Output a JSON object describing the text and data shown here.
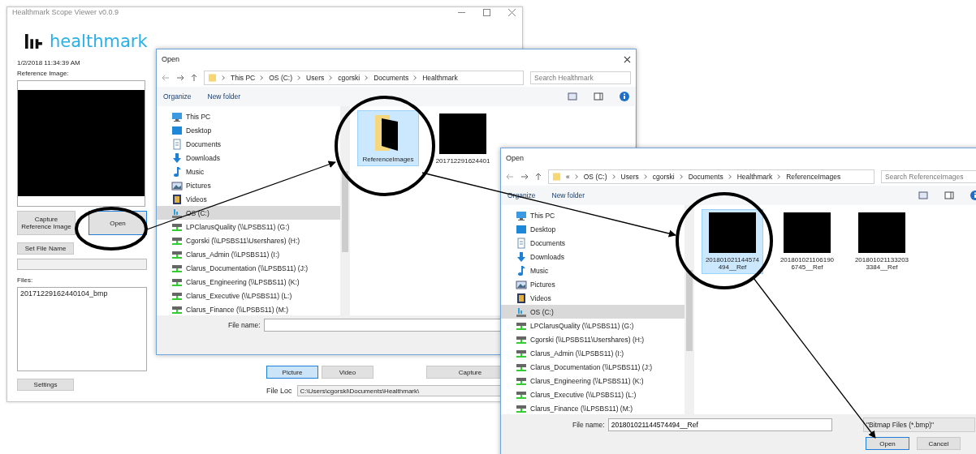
{
  "main_window": {
    "title": "Healthmark Scope Viewer v0.0.9",
    "logo_text": "healthmark",
    "datetime": "1/2/2018 11:34:39 AM",
    "reference_label": "Reference Image:",
    "action_buttons": [
      {
        "label": "Capture Reference Image",
        "focused": false
      },
      {
        "label": "Open",
        "focused": true
      }
    ],
    "set_file_name": "Set File Name",
    "files_label": "Files:",
    "files": [
      "20171229162440104_bmp"
    ],
    "settings": "Settings",
    "mode_buttons": [
      {
        "label": "Picture",
        "selected": true
      },
      {
        "label": "Video",
        "selected": false
      }
    ],
    "capture": "Capture",
    "file_loc_label": "File Loc",
    "file_loc_value": "C:\\Users\\cgorski\\Documents\\Healthmark\\"
  },
  "dialogs": [
    {
      "title": "Open",
      "closable": true,
      "breadcrumb": [
        "This PC",
        "OS (C:)",
        "Users",
        "cgorski",
        "Documents",
        "Healthmark"
      ],
      "search_placeholder": "Search Healthmark",
      "toolbar": [
        "Organize",
        "New folder"
      ],
      "nav_items": [
        {
          "label": "This PC",
          "kind": "pc",
          "selected": false
        },
        {
          "label": "Desktop",
          "kind": "desktop",
          "selected": false
        },
        {
          "label": "Documents",
          "kind": "documents",
          "selected": false
        },
        {
          "label": "Downloads",
          "kind": "downloads",
          "selected": false
        },
        {
          "label": "Music",
          "kind": "music",
          "selected": false
        },
        {
          "label": "Pictures",
          "kind": "pictures",
          "selected": false
        },
        {
          "label": "Videos",
          "kind": "videos",
          "selected": false
        },
        {
          "label": "OS (C:)",
          "kind": "drive",
          "selected": true
        },
        {
          "label": "LPClarusQuality (\\\\LPSBS11) (G:)",
          "kind": "network",
          "selected": false
        },
        {
          "label": "Cgorski (\\\\LPSBS11\\Usershares) (H:)",
          "kind": "network",
          "selected": false
        },
        {
          "label": "Clarus_Admin (\\\\LPSBS11) (I:)",
          "kind": "network",
          "selected": false
        },
        {
          "label": "Clarus_Documentation (\\\\LPSBS11) (J:)",
          "kind": "network",
          "selected": false
        },
        {
          "label": "Clarus_Engineering (\\\\LPSBS11) (K:)",
          "kind": "network",
          "selected": false
        },
        {
          "label": "Clarus_Executive (\\\\LPSBS11) (L:)",
          "kind": "network",
          "selected": false
        },
        {
          "label": "Clarus_Finance (\\\\LPSBS11) (M:)",
          "kind": "network",
          "selected": false
        }
      ],
      "files": [
        {
          "label": "ReferenceImages",
          "kind": "folder",
          "selected": true
        },
        {
          "label": "201712291624401",
          "kind": "image",
          "selected": false
        }
      ],
      "file_name_label": "File name:"
    },
    {
      "title": "Open",
      "closable": false,
      "breadcrumb": [
        "«",
        "OS (C:)",
        "Users",
        "cgorski",
        "Documents",
        "Healthmark",
        "ReferenceImages"
      ],
      "search_placeholder": "Search ReferenceImages",
      "toolbar": [
        "Organize",
        "New folder"
      ],
      "nav_items": [
        {
          "label": "This PC",
          "kind": "pc",
          "selected": false
        },
        {
          "label": "Desktop",
          "kind": "desktop",
          "selected": false
        },
        {
          "label": "Documents",
          "kind": "documents",
          "selected": false
        },
        {
          "label": "Downloads",
          "kind": "downloads",
          "selected": false
        },
        {
          "label": "Music",
          "kind": "music",
          "selected": false
        },
        {
          "label": "Pictures",
          "kind": "pictures",
          "selected": false
        },
        {
          "label": "Videos",
          "kind": "videos",
          "selected": false
        },
        {
          "label": "OS (C:)",
          "kind": "drive",
          "selected": true
        },
        {
          "label": "LPClarusQuality (\\\\LPSBS11) (G:)",
          "kind": "network",
          "selected": false
        },
        {
          "label": "Cgorski (\\\\LPSBS11\\Usershares) (H:)",
          "kind": "network",
          "selected": false
        },
        {
          "label": "Clarus_Admin (\\\\LPSBS11) (I:)",
          "kind": "network",
          "selected": false
        },
        {
          "label": "Clarus_Documentation (\\\\LPSBS11) (J:)",
          "kind": "network",
          "selected": false
        },
        {
          "label": "Clarus_Engineering (\\\\LPSBS11) (K:)",
          "kind": "network",
          "selected": false
        },
        {
          "label": "Clarus_Executive (\\\\LPSBS11) (L:)",
          "kind": "network",
          "selected": false
        },
        {
          "label": "Clarus_Finance (\\\\LPSBS11) (M:)",
          "kind": "network",
          "selected": false
        }
      ],
      "files": [
        {
          "label": "201801021144574494__Ref",
          "kind": "image",
          "selected": true
        },
        {
          "label": "201801021106190 6745__Ref",
          "kind": "image",
          "selected": false
        },
        {
          "label": "201801021133203 3384__Ref",
          "kind": "image",
          "selected": false
        }
      ],
      "file_name_label": "File name:",
      "file_name_value": "201801021144574494__Ref",
      "file_type": "\"Bitmap Files (*.bmp)\"",
      "buttons": [
        {
          "label": "Open",
          "focused": true
        },
        {
          "label": "Cancel",
          "focused": false
        }
      ]
    }
  ]
}
